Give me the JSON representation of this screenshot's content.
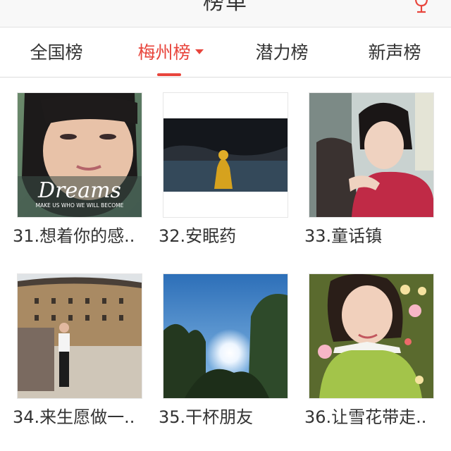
{
  "header": {
    "title": "榜单",
    "mic_icon": "microphone-icon"
  },
  "tabs": [
    {
      "label": "全国榜",
      "active": false
    },
    {
      "label": "梅州榜",
      "active": true
    },
    {
      "label": "潜力榜",
      "active": false
    },
    {
      "label": "新声榜",
      "active": false
    }
  ],
  "accent_color": "#e8453c",
  "songs": [
    {
      "label": "31.想着你的感..",
      "cover": "woman-portrait-dreams",
      "cover_text": {
        "big": "Dreams",
        "small": "MAKE US WHO WE WILL BECOME"
      }
    },
    {
      "label": "32.安眠药",
      "cover": "yellow-raincoat-sea"
    },
    {
      "label": "33.童话镇",
      "cover": "girl-portrait-red-shirt"
    },
    {
      "label": "34.来生愿做一..",
      "cover": "man-before-tulou"
    },
    {
      "label": "35.干杯朋友",
      "cover": "sunlight-through-trees"
    },
    {
      "label": "36.让雪花带走..",
      "cover": "woman-with-flowers"
    }
  ]
}
